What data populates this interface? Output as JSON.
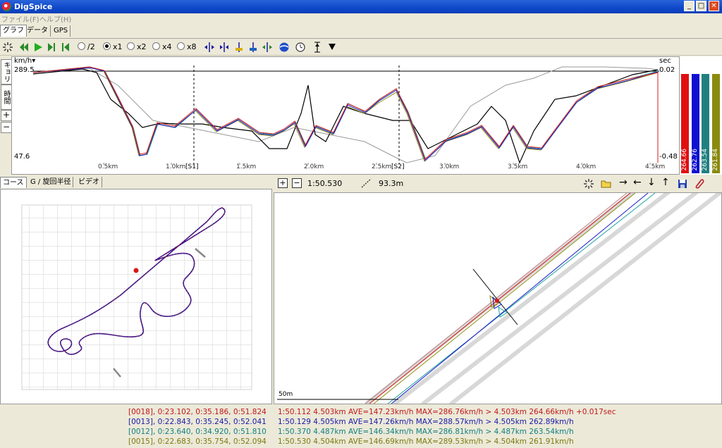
{
  "window": {
    "title": "DigSpice",
    "min": "_",
    "max": "□",
    "close": "✕"
  },
  "menu": [
    {
      "label": "ファイル(F)"
    },
    {
      "label": "ヘルプ(H)"
    }
  ],
  "top_tabs": [
    {
      "label": "グラフ"
    },
    {
      "label": "データ"
    },
    {
      "label": "GPS"
    }
  ],
  "toolbar": {
    "speeds": [
      {
        "label": "/2",
        "selected": false
      },
      {
        "label": "x1",
        "selected": true
      },
      {
        "label": "x2",
        "selected": false
      },
      {
        "label": "x4",
        "selected": false
      },
      {
        "label": "x8",
        "selected": false
      }
    ]
  },
  "side_tabs": [
    {
      "label": "キョリ"
    },
    {
      "label": "時間"
    }
  ],
  "side_buttons": {
    "plus": "+",
    "minus": "−"
  },
  "graph": {
    "y_unit": "km/h▾",
    "y_max": "289.5",
    "y_min": "47.6",
    "right_unit": "sec",
    "right_max": "0.02",
    "right_min": "-0.48",
    "x_ticks": [
      "0.5km",
      "1.0km",
      "1.5km",
      "2.0km",
      "2.5km",
      "3.0km",
      "3.5km",
      "4.0km",
      "4.5km"
    ],
    "sector_labels": [
      "[S1]",
      "[S2]"
    ],
    "series_colors": [
      "#d81818",
      "#1818c8",
      "#20a0a0",
      "#8c8c10",
      "#000000",
      "#999999"
    ]
  },
  "max_bars": [
    {
      "value": "264.66",
      "color": "#e01010"
    },
    {
      "value": "262.76",
      "color": "#1010d0"
    },
    {
      "value": "263.54",
      "color": "#208080"
    },
    {
      "value": "261.84",
      "color": "#8a8a10"
    }
  ],
  "course_tabs": [
    {
      "label": "コース"
    },
    {
      "label": "G / 旋回半径"
    },
    {
      "label": "ビデオ"
    }
  ],
  "zoom_toolbar": {
    "plus": "+",
    "minus": "−",
    "time": "1:50.530",
    "distance": "93.3m"
  },
  "zoom": {
    "scale_label": "50m"
  },
  "laps_left": [
    {
      "text": "[0018], 0:23.102, 0:35.186, 0:51.824",
      "color": "#c01818"
    },
    {
      "text": "[0013], 0:22.843, 0:35.245, 0:52.041",
      "color": "#1818a8"
    },
    {
      "text": "[0012], 0:23.640, 0:34.920, 0:51.810",
      "color": "#108080"
    },
    {
      "text": "[0015], 0:22.683, 0:35.754, 0:52.094",
      "color": "#7a7a10"
    }
  ],
  "laps_right": [
    {
      "text": "1:50.112 4.503km AVE=147.23km/h MAX=286.76km/h > 4.503km 264.66km/h +0.017sec",
      "color": "#c01818"
    },
    {
      "text": "1:50.129 4.505km AVE=147.26km/h MAX=288.57km/h > 4.505km 262.89km/h",
      "color": "#1818a8"
    },
    {
      "text": "1:50.370 4.487km AVE=146.34km/h MAX=286.81km/h > 4.487km 263.54km/h",
      "color": "#108080"
    },
    {
      "text": "1:50.530 4.504km AVE=146.69km/h MAX=289.53km/h > 4.504km 261.91km/h",
      "color": "#7a7a10"
    }
  ]
}
